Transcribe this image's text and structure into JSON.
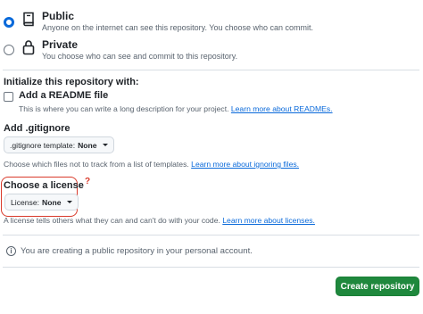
{
  "visibility": {
    "public": {
      "label": "Public",
      "description": "Anyone on the internet can see this repository. You choose who can commit.",
      "selected": true
    },
    "private": {
      "label": "Private",
      "description": "You choose who can see and commit to this repository.",
      "selected": false
    }
  },
  "initialize": {
    "title": "Initialize this repository with:",
    "readme_label": "Add a README file",
    "readme_desc": "This is where you can write a long description for your project.",
    "readme_link": "Learn more about READMEs."
  },
  "gitignore": {
    "title": "Add .gitignore",
    "dropdown_prefix": ".gitignore template:",
    "dropdown_value": "None",
    "help": "Choose which files not to track from a list of templates.",
    "help_link": "Learn more about ignoring files."
  },
  "license": {
    "title": "Choose a license",
    "annotation": "?",
    "dropdown_prefix": "License:",
    "dropdown_value": "None",
    "help": "A license tells others what they can and can't do with your code.",
    "help_link": "Learn more about licenses."
  },
  "info": {
    "icon": "info-icon",
    "text": "You are creating a public repository in your personal account."
  },
  "create_button": "Create repository",
  "colors": {
    "accent": "#0969da",
    "primary_button": "#1f883d",
    "highlight": "#d93a2b"
  }
}
